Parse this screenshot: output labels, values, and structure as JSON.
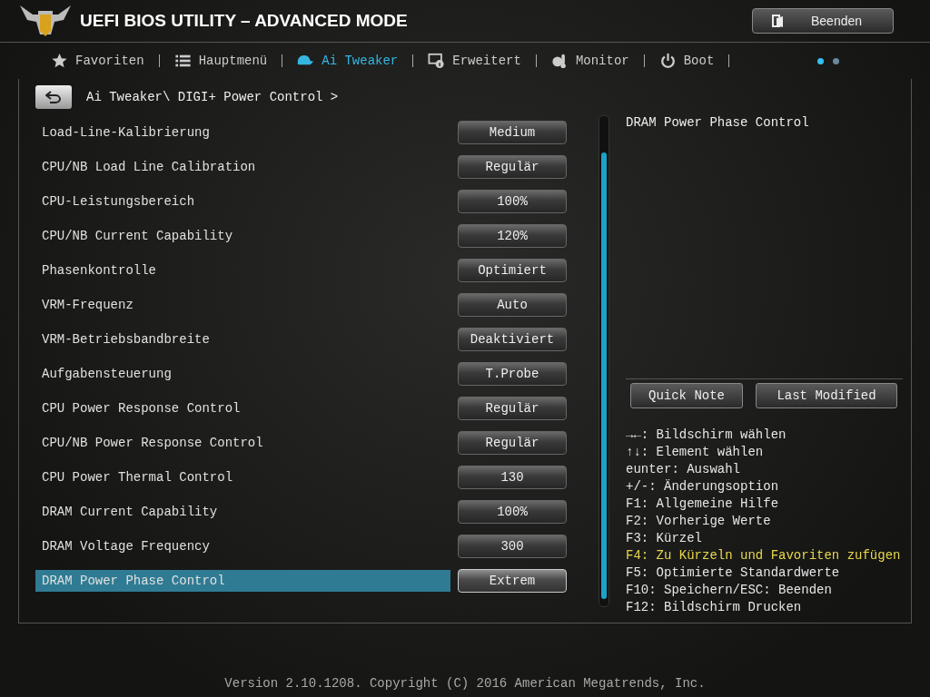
{
  "header": {
    "title": "UEFI BIOS UTILITY – ADVANCED MODE",
    "exit_button": "Beenden"
  },
  "tabs": [
    {
      "label": "Favoriten",
      "selected": false
    },
    {
      "label": "Hauptmenü",
      "selected": false
    },
    {
      "label": "Ai Tweaker",
      "selected": true
    },
    {
      "label": "Erweitert",
      "selected": false
    },
    {
      "label": "Monitor",
      "selected": false
    },
    {
      "label": "Boot",
      "selected": false
    }
  ],
  "pages": [
    {
      "selected": true
    },
    {
      "selected": false
    }
  ],
  "breadcrumb": "Ai Tweaker\\ DIGI+ Power Control >",
  "settings": [
    {
      "label": "Load-Line-Kalibrierung",
      "value": "Medium",
      "selected": false
    },
    {
      "label": "CPU/NB Load Line Calibration",
      "value": "Regulär",
      "selected": false
    },
    {
      "label": "CPU-Leistungsbereich",
      "value": "100%",
      "selected": false
    },
    {
      "label": "CPU/NB Current Capability",
      "value": "120%",
      "selected": false
    },
    {
      "label": "Phasenkontrolle",
      "value": "Optimiert",
      "selected": false
    },
    {
      "label": "VRM-Frequenz",
      "value": "Auto",
      "selected": false
    },
    {
      "label": "VRM-Betriebsbandbreite",
      "value": "Deaktiviert",
      "selected": false
    },
    {
      "label": "Aufgabensteuerung",
      "value": "T.Probe",
      "selected": false
    },
    {
      "label": "CPU Power Response Control",
      "value": "Regulär",
      "selected": false
    },
    {
      "label": "CPU/NB Power Response Control",
      "value": "Regulär",
      "selected": false
    },
    {
      "label": "CPU Power Thermal Control",
      "value": "130",
      "selected": false
    },
    {
      "label": "DRAM Current Capability",
      "value": "100%",
      "selected": false
    },
    {
      "label": "DRAM Voltage Frequency",
      "value": "300",
      "selected": false
    },
    {
      "label": "DRAM Power Phase Control",
      "value": "Extrem",
      "selected": true
    }
  ],
  "help": {
    "title": "DRAM Power Phase Control",
    "buttons": [
      "Quick Note",
      "Last Modified"
    ],
    "keys": [
      {
        "text": "→←: Bildschirm wählen",
        "highlighted": false
      },
      {
        "text": "↑↓: Element wählen",
        "highlighted": false
      },
      {
        "text": "eunter: Auswahl",
        "highlighted": false
      },
      {
        "text": "+/-: Änderungsoption",
        "highlighted": false
      },
      {
        "text": "F1: Allgemeine Hilfe",
        "highlighted": false
      },
      {
        "text": "F2: Vorherige Werte",
        "highlighted": false
      },
      {
        "text": "F3: Kürzel",
        "highlighted": false
      },
      {
        "text": "F4: Zu Kürzeln und Favoriten zufügen",
        "highlighted": true
      },
      {
        "text": "F5: Optimierte Standardwerte",
        "highlighted": false
      },
      {
        "text": "F10: Speichern/ESC: Beenden",
        "highlighted": false
      },
      {
        "text": "F12: Bildschirm Drucken",
        "highlighted": false
      }
    ]
  },
  "footer": "Version 2.10.1208. Copyright (C) 2016 American Megatrends, Inc."
}
